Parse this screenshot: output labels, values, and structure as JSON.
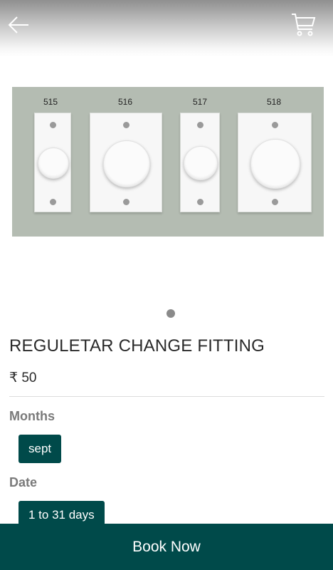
{
  "header": {
    "back_icon": "back-arrow-icon",
    "cart_icon": "cart-icon"
  },
  "product": {
    "image_labels": [
      "515",
      "516",
      "517",
      "518"
    ],
    "title": "REGULETAR CHANGE FITTING",
    "price": "₹ 50",
    "carousel_pages": 1,
    "carousel_active": 1
  },
  "options": {
    "months_label": "Months",
    "months_value": "sept",
    "date_label": "Date",
    "date_value": "1 to 31 days"
  },
  "footer": {
    "book_label": "Book Now"
  },
  "colors": {
    "accent": "#004a4a",
    "image_background": "#b4bcb2"
  }
}
